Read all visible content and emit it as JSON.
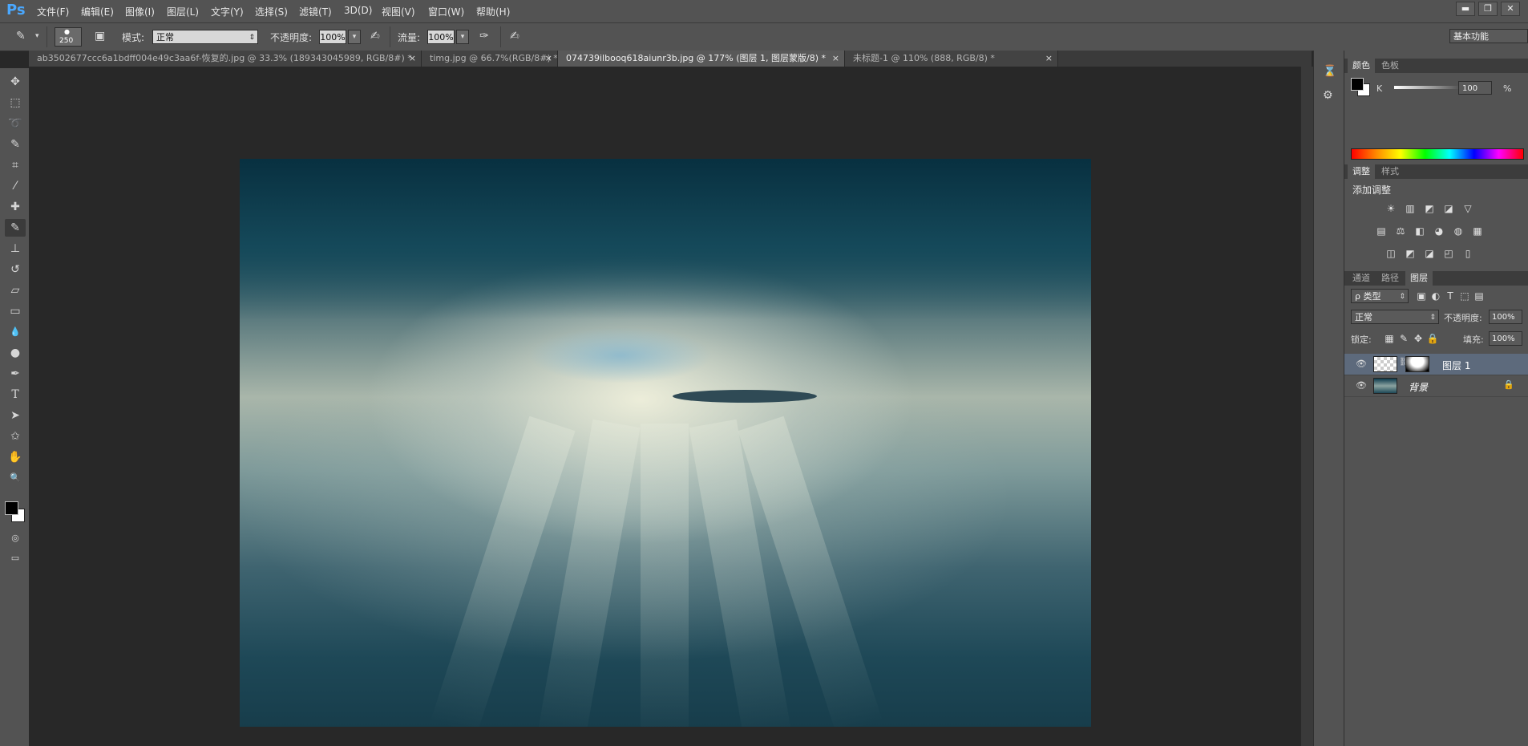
{
  "app": {
    "logo": "Ps"
  },
  "menu": [
    "文件(F)",
    "编辑(E)",
    "图像(I)",
    "图层(L)",
    "文字(Y)",
    "选择(S)",
    "滤镜(T)",
    "3D(D)",
    "视图(V)",
    "窗口(W)",
    "帮助(H)"
  ],
  "window_controls": {
    "minimize": "▬",
    "restore": "❐",
    "close": "✕"
  },
  "options": {
    "brush_size": "250",
    "mode_label": "模式:",
    "mode_value": "正常",
    "opacity_label": "不透明度:",
    "opacity_value": "100%",
    "flow_label": "流量:",
    "flow_value": "100%",
    "workspace": "基本功能"
  },
  "tabs": [
    {
      "label": "ab3502677ccc6a1bdff004e49c3aa6f-恢复的.jpg @ 33.3% (189343045989, RGB/8#) *",
      "active": false
    },
    {
      "label": "timg.jpg @ 66.7%(RGB/8#) *",
      "active": false
    },
    {
      "label": "074739ilbooq618aiunr3b.jpg @ 177% (图层 1, 图层蒙版/8) *",
      "active": true
    },
    {
      "label": "未标题-1 @ 110% (888, RGB/8) *",
      "active": false
    }
  ],
  "tab_close": "×",
  "tools": [
    {
      "name": "move-tool-icon",
      "glyph": "✥"
    },
    {
      "name": "marquee-tool-icon",
      "glyph": "⬚"
    },
    {
      "name": "lasso-tool-icon",
      "glyph": "➰"
    },
    {
      "name": "quick-select-tool-icon",
      "glyph": "✎"
    },
    {
      "name": "crop-tool-icon",
      "glyph": "⌗"
    },
    {
      "name": "eyedropper-tool-icon",
      "glyph": "⁄"
    },
    {
      "name": "healing-brush-tool-icon",
      "glyph": "✚"
    },
    {
      "name": "brush-tool-icon",
      "glyph": "✎"
    },
    {
      "name": "clone-stamp-tool-icon",
      "glyph": "⊥"
    },
    {
      "name": "history-brush-tool-icon",
      "glyph": "↺"
    },
    {
      "name": "eraser-tool-icon",
      "glyph": "▱"
    },
    {
      "name": "gradient-tool-icon",
      "glyph": "▭"
    },
    {
      "name": "blur-tool-icon",
      "glyph": "💧"
    },
    {
      "name": "dodge-tool-icon",
      "glyph": "●"
    },
    {
      "name": "pen-tool-icon",
      "glyph": "✒"
    },
    {
      "name": "type-tool-icon",
      "glyph": "T"
    },
    {
      "name": "path-selection-tool-icon",
      "glyph": "➤"
    },
    {
      "name": "shape-tool-icon",
      "glyph": "✩"
    },
    {
      "name": "hand-tool-icon",
      "glyph": "✋"
    },
    {
      "name": "zoom-tool-icon",
      "glyph": "🔍"
    }
  ],
  "color_panel": {
    "tabs": [
      "颜色",
      "色板"
    ],
    "channel": "K",
    "value": "100",
    "unit": "%"
  },
  "adjust_panel": {
    "tabs": [
      "调整",
      "样式"
    ],
    "title": "添加调整",
    "row1": [
      "☀",
      "▥",
      "◩",
      "◪",
      "▽"
    ],
    "row2": [
      "▤",
      "⚖",
      "◧",
      "◕",
      "◍",
      "▦"
    ],
    "row3": [
      "◫",
      "◩",
      "◪",
      "◰",
      "▯"
    ]
  },
  "layers_panel": {
    "tabs": [
      "通道",
      "路径",
      "图层"
    ],
    "filter_label": "ρ 类型",
    "blend_mode": "正常",
    "opacity_label": "不透明度:",
    "opacity_value": "100%",
    "lock_label": "锁定:",
    "fill_label": "填充:",
    "fill_value": "100%",
    "layers": [
      {
        "name": "图层 1",
        "active": true
      },
      {
        "name": "背景",
        "active": false
      }
    ]
  },
  "colors": {
    "menubar": "#535353",
    "canvas_bg": "#282828",
    "active_layer": "#5d6a7c"
  }
}
